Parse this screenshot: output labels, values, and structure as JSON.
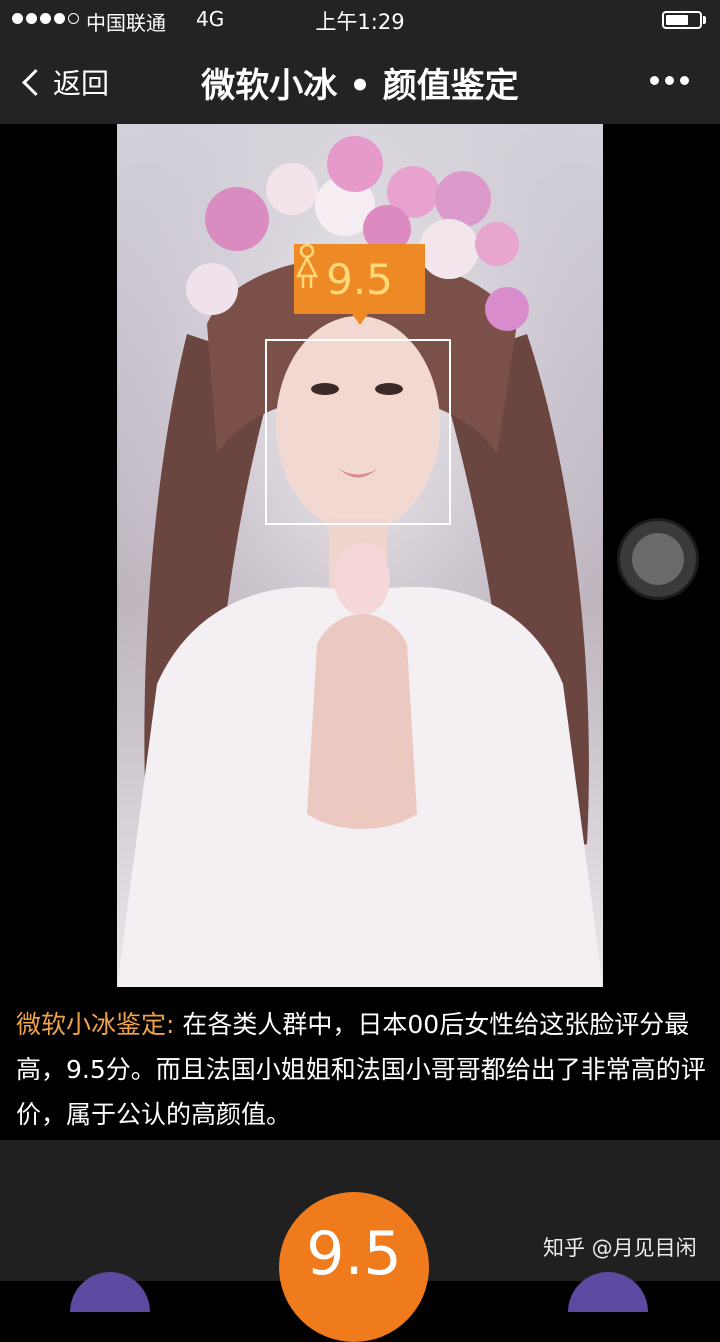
{
  "status_bar": {
    "carrier": "中国联通",
    "network": "4G",
    "time": "上午1:29",
    "signal_bars_filled": 4,
    "signal_bars_total": 5,
    "battery_level": 0.7
  },
  "nav": {
    "back_label": "返回",
    "title": "微软小冰 • 颜值鉴定",
    "back_icon": "chevron-left-icon",
    "more_icon": "more-dots-icon"
  },
  "photo": {
    "score_tag": "9.5",
    "gender_icon": "female-icon"
  },
  "verdict": {
    "label": "微软小冰鉴定:",
    "text": "在各类人群中，日本00后女性给这张脸评分最高，9.5分。而且法国小姐姐和法国小哥哥都给出了非常高的评价，属于公认的高颜值。"
  },
  "score_bubble": "9.5",
  "watermark": "知乎 @月见目闲",
  "colors": {
    "accent_orange": "#ef7b1c",
    "label_orange": "#f0a24a",
    "bar_bg": "#232323"
  }
}
